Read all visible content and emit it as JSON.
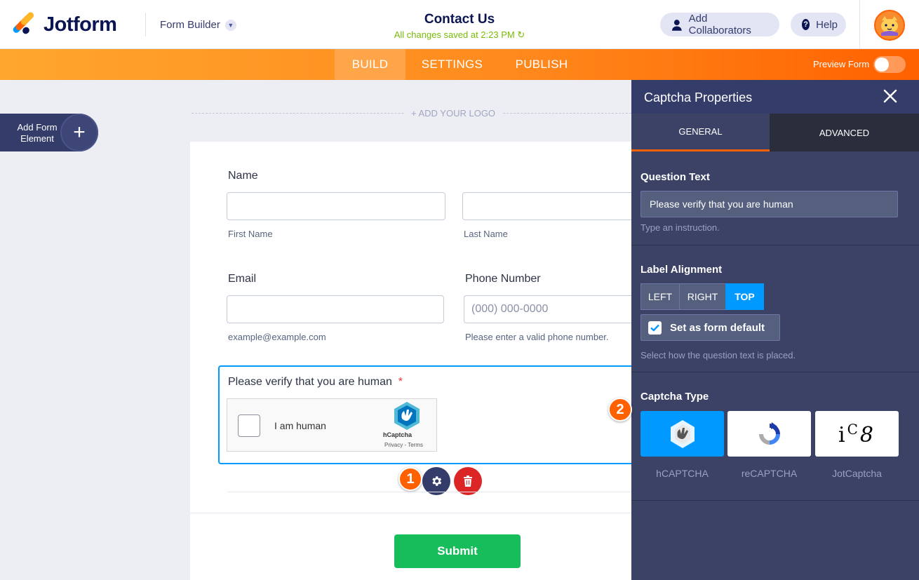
{
  "header": {
    "brand": "Jotform",
    "builder_menu": "Form Builder",
    "form_title": "Contact Us",
    "save_status": "All changes saved at 2:23 PM",
    "collaborators_label": "Add Collaborators",
    "help_label": "Help"
  },
  "nav": {
    "tabs": [
      "BUILD",
      "SETTINGS",
      "PUBLISH"
    ],
    "active_tab": "BUILD",
    "preview_label": "Preview Form",
    "preview_enabled": false
  },
  "canvas": {
    "add_element_label": "Add Form Element",
    "add_logo_label": "+ ADD YOUR LOGO"
  },
  "form": {
    "name": {
      "label": "Name",
      "first_sublabel": "First Name",
      "last_sublabel": "Last Name"
    },
    "email": {
      "label": "Email",
      "sublabel": "example@example.com"
    },
    "phone": {
      "label": "Phone Number",
      "placeholder": "(000) 000-0000",
      "sublabel": "Please enter a valid phone number."
    },
    "captcha": {
      "question": "Please verify that you are human",
      "required_mark": "*",
      "checkbox_text": "I am human",
      "brand": "hCaptcha",
      "terms": "Privacy - Terms"
    },
    "submit_label": "Submit"
  },
  "badges": {
    "settings_step": "1",
    "captcha_type_step": "2"
  },
  "panel": {
    "title": "Captcha Properties",
    "tabs": [
      "GENERAL",
      "ADVANCED"
    ],
    "active_tab": "GENERAL",
    "question_text": {
      "title": "Question Text",
      "value": "Please verify that you are human",
      "hint": "Type an instruction."
    },
    "label_alignment": {
      "title": "Label Alignment",
      "options": [
        "LEFT",
        "RIGHT",
        "TOP"
      ],
      "selected": "TOP",
      "default_label": "Set as form default",
      "default_checked": true,
      "hint": "Select how the question text is placed."
    },
    "captcha_type": {
      "title": "Captcha Type",
      "options": [
        "hCAPTCHA",
        "reCAPTCHA",
        "JotCaptcha"
      ],
      "selected": "hCAPTCHA",
      "jotcaptcha_sample": "iC8"
    }
  },
  "colors": {
    "brand_orange": "#ff6100",
    "accent_blue": "#0099ff",
    "submit_green": "#18bd5b",
    "panel_bg": "#3c4166",
    "delete_red": "#dc2626"
  }
}
